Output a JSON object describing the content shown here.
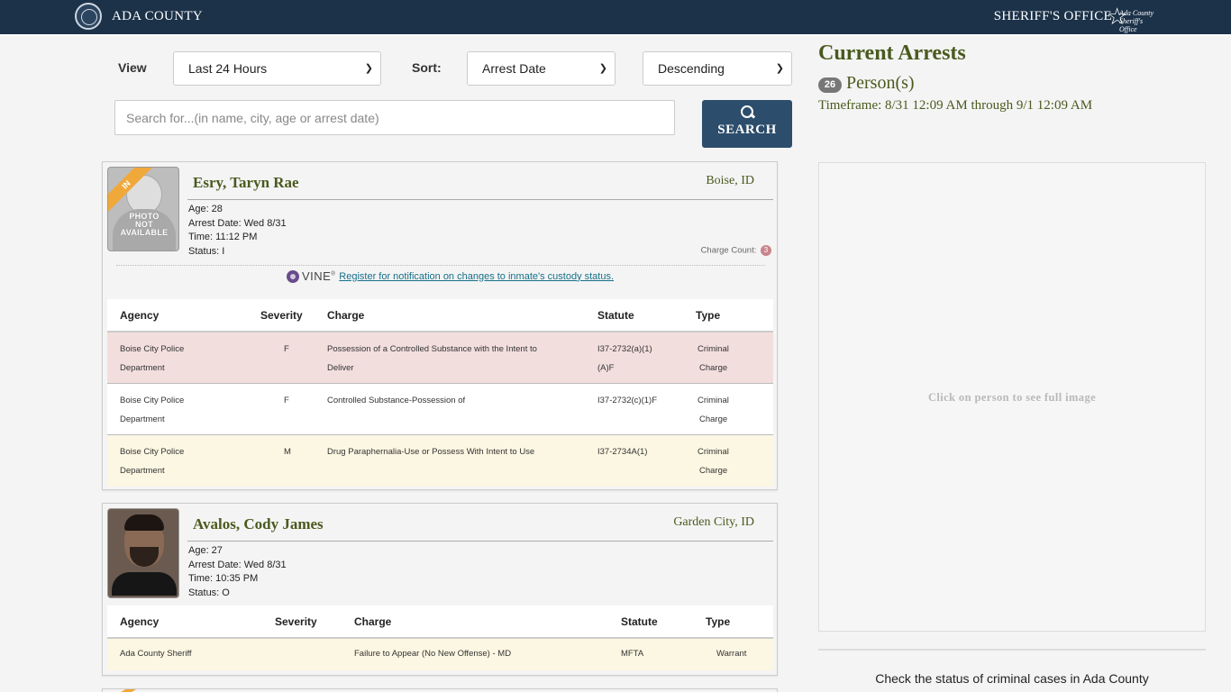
{
  "header": {
    "county": "ADA COUNTY",
    "office": "SHERIFF'S OFFICE",
    "logo_text": [
      "Ada County",
      "Sheriff's Office"
    ]
  },
  "filters": {
    "view_label": "View",
    "view_value": "Last 24 Hours",
    "sort_label": "Sort:",
    "sort_value": "Arrest Date",
    "order_value": "Descending",
    "search_placeholder": "Search for...(in name, city, age or arrest date)",
    "search_button": "SEARCH"
  },
  "table_headers": [
    "Agency",
    "Severity",
    "Charge",
    "Statute",
    "Type"
  ],
  "arrests": [
    {
      "name": "Esry, Taryn Rae",
      "city": "Boise, ID",
      "status_ribbon": "IN",
      "photo_text": [
        "PHOTO",
        "NOT",
        "AVAILABLE"
      ],
      "age": "Age: 28",
      "arrest_date": "Arrest Date: Wed 8/31",
      "time": "Time: 11:12 PM",
      "status": "Status: I",
      "charge_count_label": "Charge Count:",
      "charge_count": "3",
      "vine_label": "VINE",
      "vine_link": "Register for notification on changes to inmate's custody status.",
      "charges": [
        {
          "agency": [
            "Boise City Police",
            "Department"
          ],
          "severity": "F",
          "charge": [
            "Possession of a Controlled Substance with the Intent to",
            "Deliver"
          ],
          "statute": [
            "I37-2732(a)(1)",
            "(A)F"
          ],
          "type": [
            "Criminal",
            "Charge"
          ]
        },
        {
          "agency": [
            "Boise City Police",
            "Department"
          ],
          "severity": "F",
          "charge": [
            "Controlled Substance-Possession of"
          ],
          "statute": [
            "I37-2732(c)(1)F"
          ],
          "type": [
            "Criminal",
            "Charge"
          ]
        },
        {
          "agency": [
            "Boise City Police",
            "Department"
          ],
          "severity": "M",
          "charge": [
            "Drug Paraphernalia-Use or Possess With Intent to Use"
          ],
          "statute": [
            "I37-2734A(1)"
          ],
          "type": [
            "Criminal",
            "Charge"
          ]
        }
      ]
    },
    {
      "name": "Avalos, Cody James",
      "city": "Garden City, ID",
      "age": "Age: 27",
      "arrest_date": "Arrest Date: Wed 8/31",
      "time": "Time: 10:35 PM",
      "status": "Status: O",
      "charges": [
        {
          "agency": [
            "Ada County Sheriff"
          ],
          "severity": "",
          "charge": [
            "Failure to Appear (No New Offense) - MD"
          ],
          "statute": [
            "MFTA"
          ],
          "type": [
            "Warrant"
          ]
        }
      ]
    }
  ],
  "summary": {
    "title": "Current Arrests",
    "count": "26",
    "persons_label": "Person(s)",
    "timeframe": "Timeframe: 8/31 12:09 AM through 9/1 12:09 AM",
    "viewer_hint": "Click on person to see full image",
    "check_status": "Check the status of criminal cases in Ada County"
  },
  "colors": {
    "header_bg": "#1c3249",
    "title_olive": "#4a5a1e",
    "search_button": "#2c4d6c",
    "row_red": "#f3dede",
    "row_yellow": "#fcf7e2",
    "ribbon": "#f0a83a"
  }
}
